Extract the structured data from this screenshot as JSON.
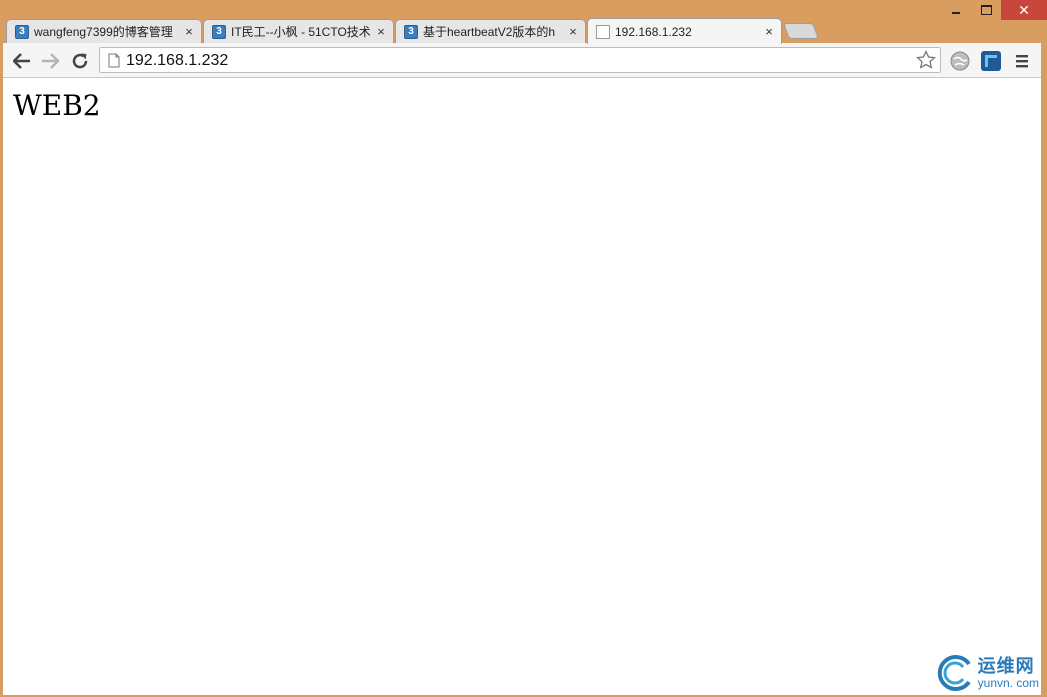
{
  "window": {
    "minimize_icon": "minimize-icon",
    "maximize_icon": "maximize-icon",
    "close_glyph": "✕"
  },
  "tabs": [
    {
      "title": "wangfeng7399的博客管理",
      "favicon": "51cto-favicon",
      "favicon_text": "3",
      "close": "×"
    },
    {
      "title": "IT民工--小枫 - 51CTO技术",
      "favicon": "51cto-favicon",
      "favicon_text": "3",
      "close": "×"
    },
    {
      "title": "基于heartbeatV2版本的h",
      "favicon": "51cto-favicon",
      "favicon_text": "3",
      "close": "×"
    },
    {
      "title": "192.168.1.232",
      "favicon": "page-icon",
      "favicon_text": "",
      "close": "×"
    }
  ],
  "toolbar": {
    "url": "192.168.1.232"
  },
  "page": {
    "heading": "WEB2"
  },
  "watermark": {
    "cn": "运维网",
    "en": "yunvn. com"
  },
  "colors": {
    "frame": "#d99d5f",
    "close_button": "#c8473b",
    "accent": "#2b7bb9"
  }
}
